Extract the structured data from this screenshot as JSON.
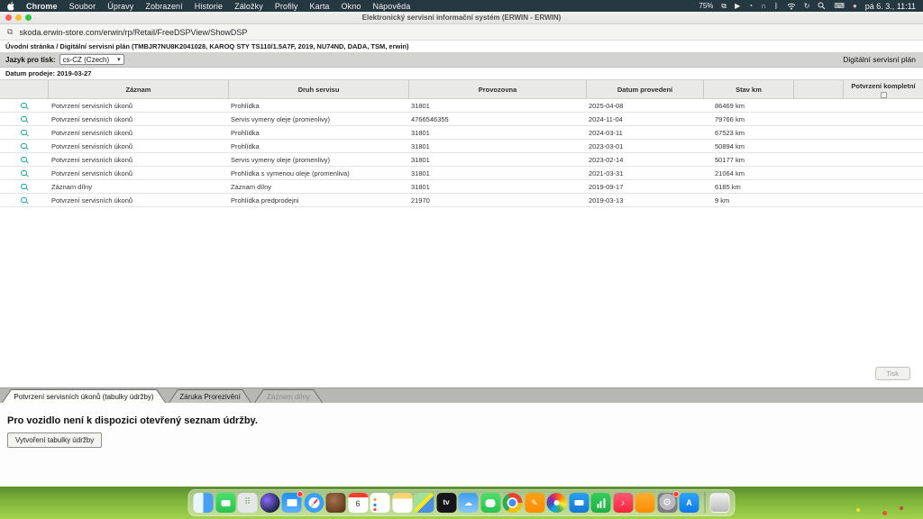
{
  "menubar": {
    "items": [
      "Chrome",
      "Soubor",
      "Úpravy",
      "Zobrazení",
      "Historie",
      "Záložky",
      "Profily",
      "Karta",
      "Okno",
      "Nápověda"
    ],
    "battery": "75%",
    "clock": "pá 6. 3., 11:11",
    "status_icons": [
      "window-stack",
      "play-circle",
      "record-timer",
      "headphones",
      "bluetooth",
      "wifi",
      "sync",
      "spotlight",
      "keyboard",
      "notification-dot"
    ]
  },
  "window": {
    "title": "Elektronický servisní informační systém (ERWIN - ERWIN)",
    "url": "skoda.erwin-store.com/erwin/rp/Retail/FreeDSPView/ShowDSP"
  },
  "breadcrumb": {
    "text": "Úvodní stránka / Digitální servisní plán (TMBJR7NU8K2041028, KAROQ STY TS110/1.5A7F, 2019, NU74ND, DADA, TSM, erwin)"
  },
  "toolbar": {
    "language_label": "Jazyk pro tisk:",
    "language_value": "cs-CZ (Czech)",
    "plan_label": "Digitální servisní plán"
  },
  "sale_date": {
    "text": "Datum prodeje: 2019-03-27"
  },
  "table": {
    "headers": {
      "record": "Záznam",
      "service": "Druh servisu",
      "branch": "Provozovna",
      "date": "Datum provedení",
      "km": "Stav km",
      "confirm": "Potvrzení kompletní"
    },
    "rows": [
      {
        "record": "Potvrzení servisních úkonů",
        "service": "Prohlídka",
        "branch": "31801",
        "date": "2025-04-08",
        "km": "86469 km"
      },
      {
        "record": "Potvrzení servisních úkonů",
        "service": "Servis vymeny oleje (promenlivy)",
        "branch": "4766546355",
        "date": "2024-11-04",
        "km": "79766 km"
      },
      {
        "record": "Potvrzení servisních úkonů",
        "service": "Prohlídka",
        "branch": "31801",
        "date": "2024-03-11",
        "km": "67523 km"
      },
      {
        "record": "Potvrzení servisních úkonů",
        "service": "Prohlídka",
        "branch": "31801",
        "date": "2023-03-01",
        "km": "50894 km"
      },
      {
        "record": "Potvrzení servisních úkonů",
        "service": "Servis vymeny oleje (promenlivy)",
        "branch": "31801",
        "date": "2023-02-14",
        "km": "50177 km"
      },
      {
        "record": "Potvrzení servisních úkonů",
        "service": "Prohlídka s vymenou oleje (promenliva)",
        "branch": "31801",
        "date": "2021-03-31",
        "km": "21064 km"
      },
      {
        "record": "Záznam dílny",
        "service": "Záznam dílny",
        "branch": "31801",
        "date": "2019-09-17",
        "km": "6185 km"
      },
      {
        "record": "Potvrzení servisních úkonů",
        "service": "Prohlídka predprodejni",
        "branch": "21970",
        "date": "2019-03-13",
        "km": "9 km"
      }
    ]
  },
  "print_button": {
    "label": "Tisk"
  },
  "tabs": [
    {
      "label": "Potvrzení servisních úkonů (tabulky údržby)",
      "state": "active"
    },
    {
      "label": "Záruka Prorezivění",
      "state": "normal"
    },
    {
      "label": "Záznam dílny",
      "state": "disabled"
    }
  ],
  "panel": {
    "message": "Pro vozidlo není k dispozici otevřený seznam údržby.",
    "create_button": "Vytvoření tabulky údržby"
  },
  "dock": {
    "calendar_day": "6",
    "tv_label": "tv",
    "app_store_letter": "A",
    "icons": [
      "finder",
      "facetime",
      "launchpad",
      "siri",
      "mail",
      "safari",
      "photo-booth",
      "calendar",
      "reminders",
      "notes",
      "maps",
      "tv",
      "weather",
      "messages",
      "chrome",
      "pages",
      "photos",
      "keynote",
      "stocks",
      "music",
      "books",
      "settings",
      "app-store",
      "trash"
    ]
  },
  "colors": {
    "menubar_bg": "#25383f",
    "accent_teal": "#1aa09a",
    "tabstrip_bg": "#b7b7b5"
  }
}
